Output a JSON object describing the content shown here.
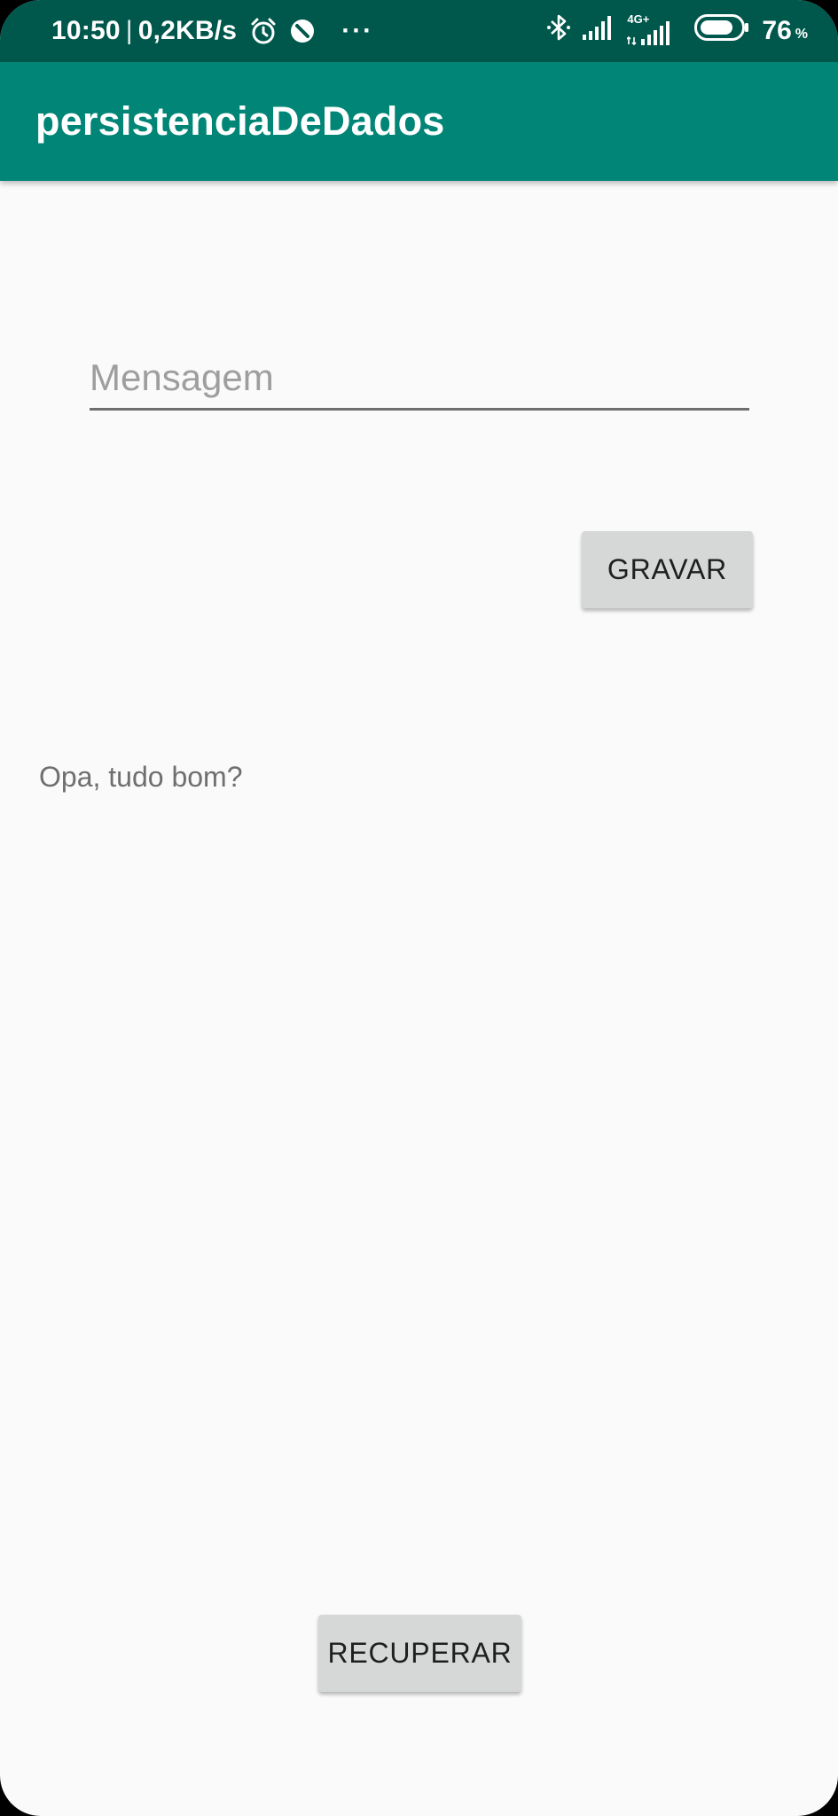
{
  "status_bar": {
    "time": "10:50",
    "separator": "|",
    "speed": "0,2KB/s",
    "more": "···",
    "network_type": "4G+",
    "battery_level": "76",
    "battery_unit": "%",
    "icons": [
      "alarm-icon",
      "do-not-disturb-icon",
      "bluetooth-icon",
      "signal-icon",
      "signal-4g-icon",
      "battery-icon"
    ]
  },
  "app_bar": {
    "title": "persistenciaDeDados"
  },
  "form": {
    "message_placeholder": "Mensagem",
    "message_value": "",
    "save_label": "GRAVAR",
    "result_text": "Opa, tudo bom?",
    "retrieve_label": "RECUPERAR"
  },
  "colors": {
    "status_bar": "#00574b",
    "app_bar": "#008577",
    "background": "#fafafa",
    "button": "#d6d7d7"
  }
}
